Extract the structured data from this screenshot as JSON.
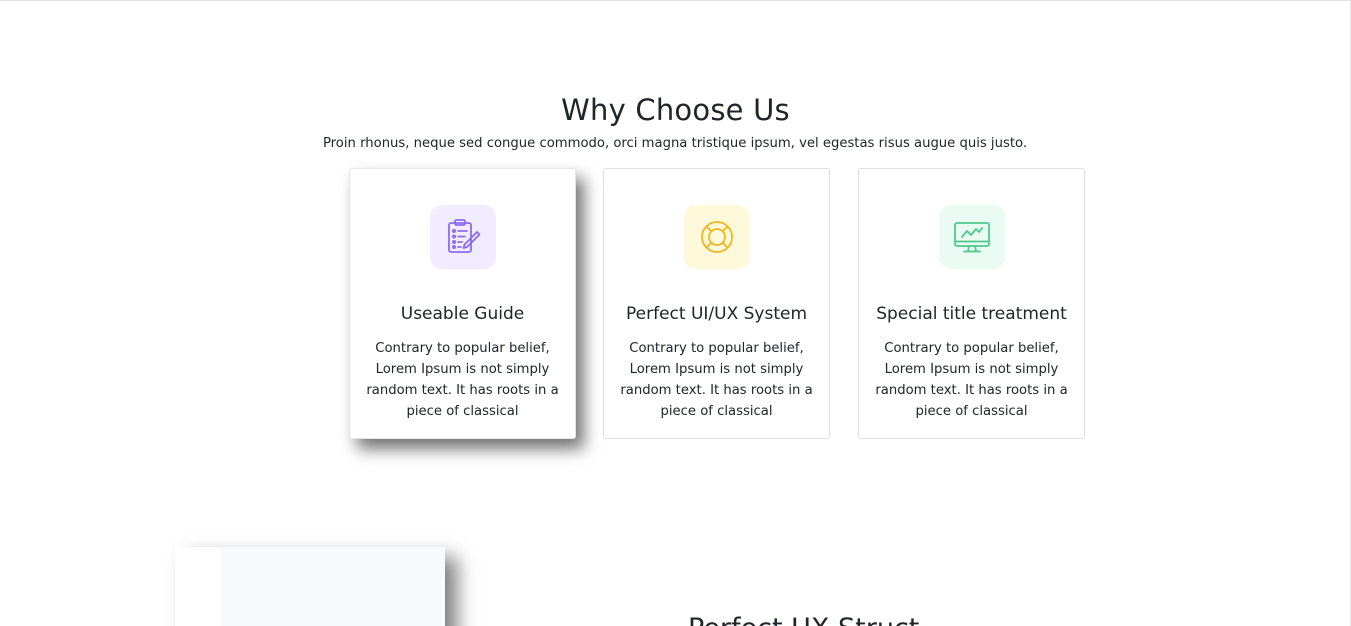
{
  "section": {
    "title": "Why Choose Us",
    "subtitle": "Proin rhonus, neque sed congue commodo, orci magna tristique ipsum, vel egestas risus augue quis justo."
  },
  "cards": [
    {
      "icon": "clipboard-edit-icon",
      "icon_color": "#8b6cf0",
      "icon_bg": "#f1ecff",
      "title": "Useable Guide",
      "text": "Contrary to popular belief, Lorem Ipsum is not simply random text. It has roots in a piece of classical"
    },
    {
      "icon": "lifebuoy-icon",
      "icon_color": "#f2b61e",
      "icon_bg": "#fff9dc",
      "title": "Perfect UI/UX System",
      "text": "Contrary to popular belief, Lorem Ipsum is not simply random text. It has roots in a piece of classical"
    },
    {
      "icon": "monitor-chart-icon",
      "icon_color": "#4cc98d",
      "icon_bg": "#e9fbf2",
      "title": "Special title treatment",
      "text": "Contrary to popular belief, Lorem Ipsum is not simply random text. It has roots in a piece of classical"
    }
  ],
  "next_section": {
    "heading": "Perfect UX Struct"
  }
}
